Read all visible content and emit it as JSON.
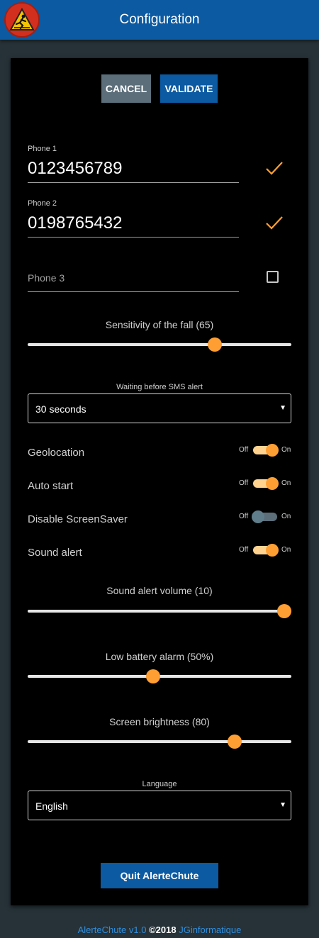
{
  "header": {
    "title": "Configuration"
  },
  "buttons": {
    "cancel": "CANCEL",
    "validate": "VALIDATE",
    "quit": "Quit AlerteChute"
  },
  "phones": [
    {
      "label": "Phone 1",
      "value": "0123456789",
      "checked": true
    },
    {
      "label": "Phone 2",
      "value": "0198765432",
      "checked": true
    },
    {
      "label": "Phone 3",
      "placeholder": "Phone 3",
      "checked": false
    }
  ],
  "sliders": [
    {
      "label": "Sensitivity of the fall (65)",
      "value": 65,
      "min": 0,
      "max": 90
    },
    {
      "label": "Sound alert volume (10)",
      "value": 10,
      "min": 0,
      "max": 10
    },
    {
      "label": "Low battery alarm (50%)",
      "value": 50,
      "min": 5,
      "max": 100
    },
    {
      "label": "Screen brightness (80)",
      "value": 80,
      "min": 0,
      "max": 100
    }
  ],
  "waiting": {
    "label": "Waiting before SMS alert",
    "value": "30 seconds"
  },
  "language": {
    "label": "Language",
    "value": "English"
  },
  "toggles": [
    {
      "label": "Geolocation",
      "off_label": "Off",
      "on_label": "On",
      "on": true
    },
    {
      "label": "Auto start",
      "off_label": "Off",
      "on_label": "On",
      "on": true
    },
    {
      "label": "Disable ScreenSaver",
      "off_label": "Off",
      "on_label": "On",
      "on": false
    },
    {
      "label": "Sound alert",
      "off_label": "Off",
      "on_label": "On",
      "on": true
    }
  ],
  "footer": {
    "app": "AlerteChute v1.0",
    "copyright": " ©2018 ",
    "company": "JGinformatique"
  },
  "colors": {
    "accent": "#ff9f33",
    "primary": "#0b5aa2",
    "background": "#263238",
    "card": "#000000"
  },
  "icons": {
    "logo": "fall-warning-logo-icon",
    "check": "check-icon",
    "caret": "caret-down-icon"
  }
}
